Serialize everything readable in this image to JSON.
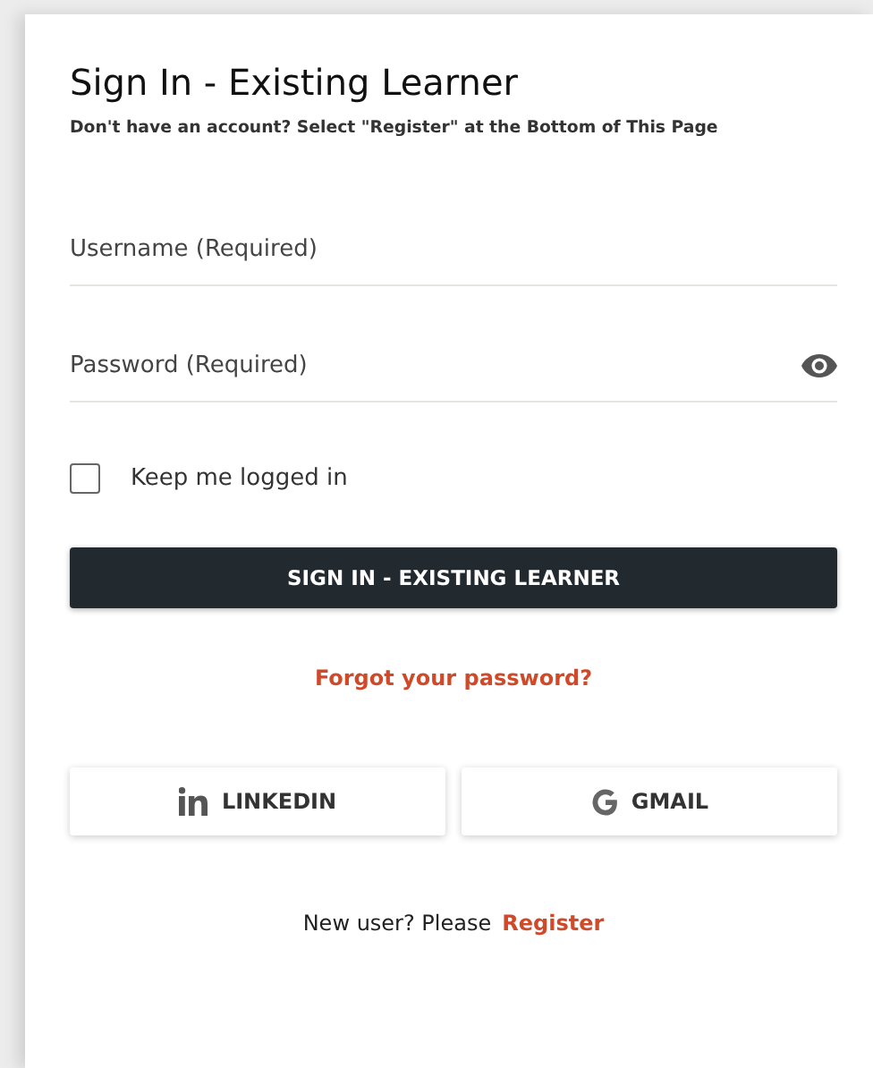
{
  "title": "Sign In - Existing Learner",
  "subtitle": "Don't have an account? Select \"Register\" at the Bottom of This Page",
  "fields": [
    {
      "kind": "text",
      "placeholder": "Username (Required)"
    },
    {
      "kind": "password",
      "placeholder": "Password (Required)"
    }
  ],
  "keep_logged_in": {
    "label": "Keep me logged in",
    "checked": false
  },
  "sign_in_button": "SIGN IN - EXISTING LEARNER",
  "forgot_link": "Forgot your password?",
  "social_buttons": [
    {
      "kind": "linkedin",
      "label": "LINKEDIN"
    },
    {
      "kind": "google",
      "label": "GMAIL"
    }
  ],
  "register": {
    "prompt": "New user? Please",
    "link": "Register"
  }
}
